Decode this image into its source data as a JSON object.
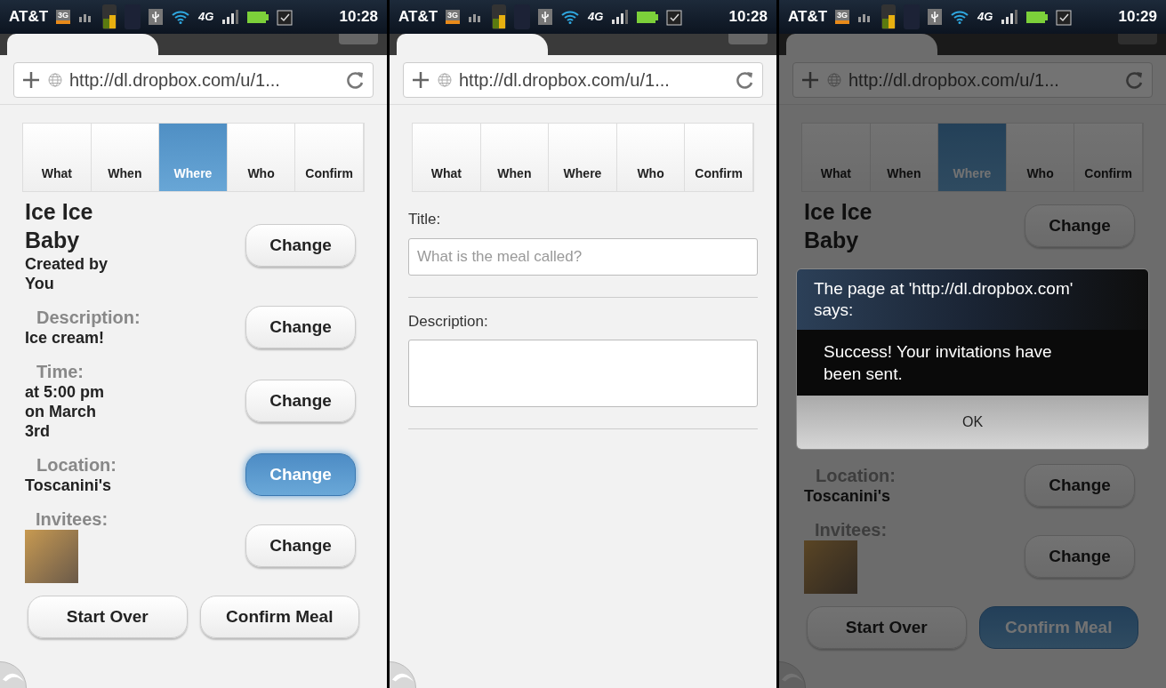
{
  "screens": [
    {
      "status_bar": {
        "carrier": "AT&T",
        "network": "3G",
        "data": "4G",
        "time": "10:28"
      },
      "url": "http://dl.dropbox.com/u/1...",
      "tabs": [
        {
          "label": "What",
          "selected": false
        },
        {
          "label": "When",
          "selected": false
        },
        {
          "label": "Where",
          "selected": true
        },
        {
          "label": "Who",
          "selected": false
        },
        {
          "label": "Confirm",
          "selected": false
        }
      ],
      "dimmed": false,
      "kind": "summary",
      "rows": [
        {
          "kind": "header",
          "title": "Ice Ice Baby",
          "subtitle": "Created by You",
          "button": {
            "label": "Change",
            "selected": false
          }
        },
        {
          "kind": "field",
          "label": "Description:",
          "value": "Ice cream!",
          "button": {
            "label": "Change",
            "selected": false
          }
        },
        {
          "kind": "field",
          "label": "Time:",
          "value": "at 5:00 pm on March 3rd",
          "button": {
            "label": "Change",
            "selected": false
          }
        },
        {
          "kind": "field",
          "label": "Location:",
          "value": "Toscanini's",
          "button": {
            "label": "Change",
            "selected": true
          }
        },
        {
          "kind": "photo",
          "label": "Invitees:",
          "button": {
            "label": "Change",
            "selected": false
          }
        }
      ],
      "actions": [
        {
          "label": "Start Over",
          "selected": false
        },
        {
          "label": "Confirm Meal",
          "selected": false
        }
      ]
    },
    {
      "status_bar": {
        "carrier": "AT&T",
        "network": "3G",
        "data": "4G",
        "time": "10:28"
      },
      "url": "http://dl.dropbox.com/u/1...",
      "tabs": [
        {
          "label": "What",
          "selected": false
        },
        {
          "label": "When",
          "selected": false
        },
        {
          "label": "Where",
          "selected": false
        },
        {
          "label": "Who",
          "selected": false
        },
        {
          "label": "Confirm",
          "selected": false
        }
      ],
      "dimmed": false,
      "kind": "form",
      "fields": [
        {
          "kind": "input",
          "label": "Title:",
          "placeholder": "What is the meal called?"
        },
        {
          "kind": "textarea",
          "label": "Description:"
        }
      ]
    },
    {
      "status_bar": {
        "carrier": "AT&T",
        "network": "3G",
        "data": "4G",
        "time": "10:29"
      },
      "url": "http://dl.dropbox.com/u/1...",
      "tabs": [
        {
          "label": "What",
          "selected": false
        },
        {
          "label": "When",
          "selected": false
        },
        {
          "label": "Where",
          "selected": true
        },
        {
          "label": "Who",
          "selected": false
        },
        {
          "label": "Confirm",
          "selected": false
        }
      ],
      "dimmed": true,
      "kind": "summary",
      "rows": [
        {
          "kind": "header",
          "title": "Ice Ice Baby",
          "button": {
            "label": "Change",
            "selected": false
          }
        },
        {
          "kind": "dialog",
          "title": "The page at 'http://dl.dropbox.com' says:",
          "message": "Success! Your invitations have been sent.",
          "button": "OK"
        },
        {
          "kind": "field",
          "label": "Location:",
          "value": "Toscanini's",
          "button": {
            "label": "Change",
            "selected": false
          }
        },
        {
          "kind": "photo",
          "label": "Invitees:",
          "button": {
            "label": "Change",
            "selected": false
          }
        }
      ],
      "actions": [
        {
          "label": "Start Over",
          "selected": false
        },
        {
          "label": "Confirm Meal",
          "selected": true
        }
      ]
    }
  ]
}
